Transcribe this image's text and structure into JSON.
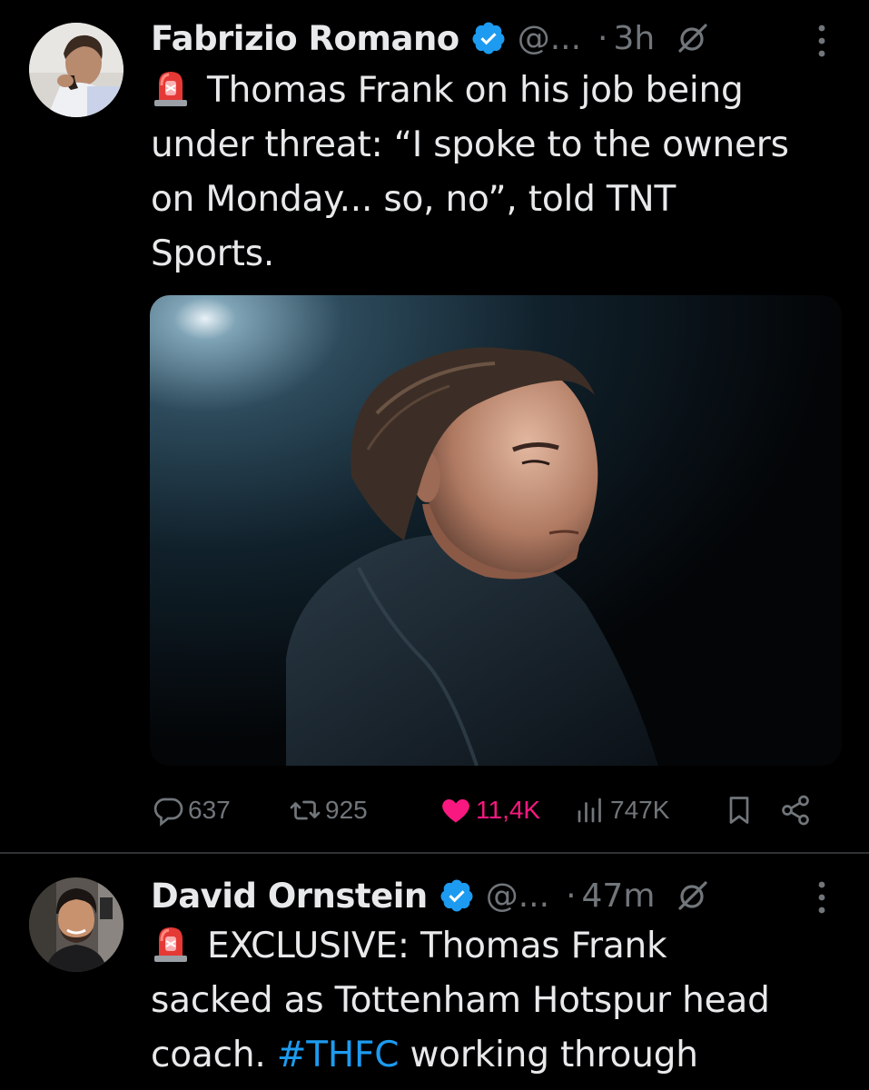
{
  "tweets": [
    {
      "author_name": "Fabrizio Romano",
      "handle": "@...",
      "separator": "·",
      "time": "3h",
      "text_lines": [
        "Thomas Frank on his job being",
        "under threat: “I spoke to the owners",
        "on Monday... so, no”, told TNT",
        "Sports."
      ],
      "actions": {
        "replies": "637",
        "reposts": "925",
        "likes": "11,4K",
        "views": "747K"
      },
      "liked": true
    },
    {
      "author_name": "David Ornstein",
      "handle": "@...",
      "separator": "·",
      "time": "47m",
      "text_lines": [
        "EXCLUSIVE: Thomas Frank",
        "sacked as Tottenham Hotspur head"
      ],
      "line3_prefix": "coach. ",
      "line3_hashtag": "#THFC",
      "line3_suffix": " working through"
    }
  ],
  "icons": {
    "verified": "verified-badge-icon",
    "grok": "grok-icon",
    "more": "more-vertical-icon",
    "siren": "siren-emoji-icon",
    "reply": "reply-icon",
    "repost": "repost-icon",
    "like": "heart-icon",
    "views": "views-icon",
    "bookmark": "bookmark-icon",
    "share": "share-icon"
  },
  "colors": {
    "background": "#000000",
    "text": "#e7e9ea",
    "muted": "#71767b",
    "verified": "#1d9bf0",
    "like": "#f91880",
    "hashtag": "#1d9bf0",
    "divider": "#2f3336"
  }
}
